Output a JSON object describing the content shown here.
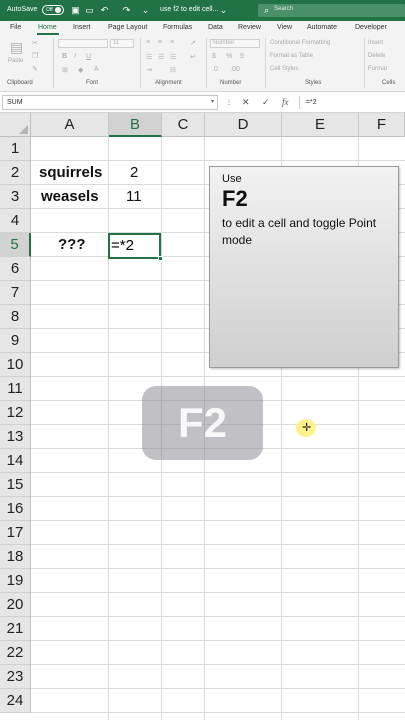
{
  "titlebar": {
    "autosave_label": "AutoSave",
    "autosave_state": "Off",
    "file_title": "use f2 to edit cell...",
    "search_placeholder": "Search"
  },
  "tabs": [
    "File",
    "Home",
    "Insert",
    "Page Layout",
    "Formulas",
    "Data",
    "Review",
    "View",
    "Automate",
    "Developer"
  ],
  "ribbon": {
    "groups": [
      "Clipboard",
      "Font",
      "Alignment",
      "Number",
      "Styles",
      "Cells"
    ],
    "paste_label": "Paste",
    "font_size": "11",
    "number_format": "Number",
    "conditional_formatting": "Conditional Formatting",
    "format_as_table": "Format as Table",
    "cell_styles": "Cell Styles",
    "insert": "Insert",
    "delete": "Delete",
    "format": "Format"
  },
  "formula_bar": {
    "name_box": "SUM",
    "cancel_icon": "✕",
    "enter_icon": "✓",
    "fx_label": "fx",
    "formula": "=*2"
  },
  "columns": [
    "A",
    "B",
    "C",
    "D",
    "E",
    "F"
  ],
  "rows": [
    "1",
    "2",
    "3",
    "4",
    "5",
    "6",
    "7",
    "8",
    "9",
    "10",
    "11",
    "12",
    "13",
    "14",
    "15",
    "16",
    "17",
    "18",
    "19",
    "20",
    "21",
    "22",
    "23",
    "24"
  ],
  "cells": {
    "a2": "squirrels",
    "b2": "2",
    "a3": "weasels",
    "b3": "11",
    "a5": "???",
    "b5": "=*2"
  },
  "tip": {
    "use": "Use",
    "key": "F2",
    "description": "to edit a cell and toggle Point mode"
  },
  "overlay": {
    "key": "F2"
  },
  "colors": {
    "accent": "#217346",
    "tip_background": "#e0e0e0"
  }
}
